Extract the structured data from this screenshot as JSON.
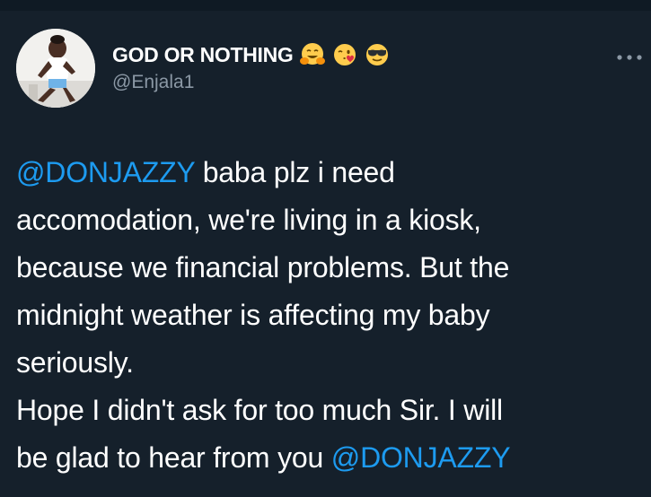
{
  "tweet": {
    "display_name": "GOD OR NOTHING",
    "name_emojis": [
      "hugging-face-emoji",
      "face-blowing-kiss-emoji",
      "sunglasses-face-emoji"
    ],
    "handle": "@Enjala1",
    "more_icon": "more-dots-icon",
    "text_lines": [
      {
        "mention": "@DONJAZZY",
        "text": " baba plz i need"
      },
      {
        "text": "accomodation, we're living in a kiosk,"
      },
      {
        "text": "because we financial problems. But the"
      },
      {
        "text": "midnight weather is affecting my baby"
      },
      {
        "text": "seriously."
      },
      {
        "text": "Hope I didn't ask for too much Sir. I will"
      },
      {
        "text": "be glad to hear from you ",
        "mention": "@DONJAZZY"
      }
    ]
  },
  "colors": {
    "background": "#15202b",
    "text": "#ffffff",
    "secondary_text": "#8b98a5",
    "mention": "#1d9bf0"
  }
}
